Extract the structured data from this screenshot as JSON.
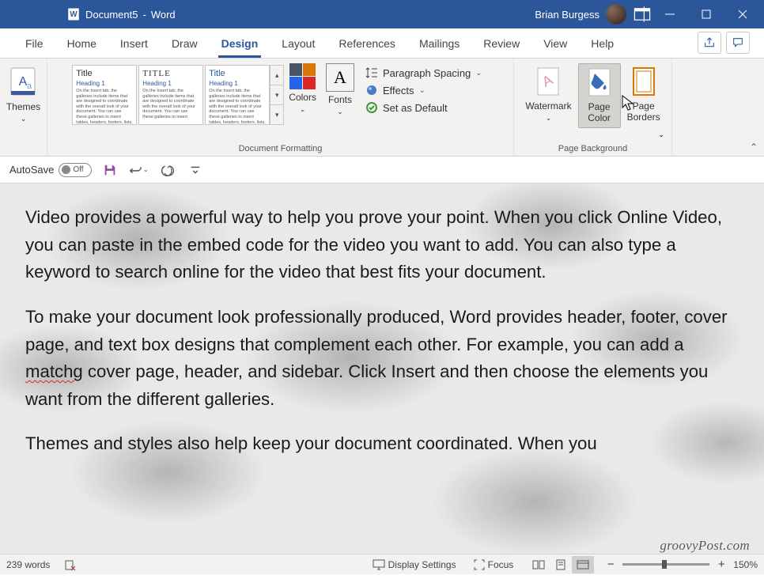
{
  "title": {
    "doc": "Document5",
    "app": "Word"
  },
  "user": {
    "name": "Brian Burgess"
  },
  "tabs": [
    "File",
    "Home",
    "Insert",
    "Draw",
    "Design",
    "Layout",
    "References",
    "Mailings",
    "Review",
    "View",
    "Help"
  ],
  "activeTab": 4,
  "ribbon": {
    "themes": "Themes",
    "formatting_label": "Document Formatting",
    "pagebg_label": "Page Background",
    "colors": "Colors",
    "fonts": "Fonts",
    "gallery": [
      {
        "title": "Title",
        "heading": "Heading 1"
      },
      {
        "title": "TITLE",
        "heading": "Heading 1"
      },
      {
        "title": "Title",
        "heading": "Heading 1"
      }
    ],
    "opts": {
      "paragraph": "Paragraph Spacing",
      "effects": "Effects",
      "default": "Set as Default"
    },
    "watermark": "Watermark",
    "pagecolor": "Page\nColor",
    "pageborders": "Page\nBorders"
  },
  "qa": {
    "autosave": "AutoSave",
    "off": "Off"
  },
  "doc": {
    "p1": "Video provides a powerful way to help you prove your point. When you click Online Video, you can paste in the embed code for the video you want to add. You can also type a keyword to search online for the video that best fits your document.",
    "p2a": "To make your document look professionally produced, Word provides header, footer, cover page, and text box designs that complement each other. For example, you can add a ",
    "p2err": "matchg",
    "p2b": " cover page, header, and sidebar. Click Insert and then choose the elements you want from the different galleries.",
    "p3": "Themes and styles also help keep your document coordinated. When you"
  },
  "status": {
    "words": "239 words",
    "display": "Display Settings",
    "focus": "Focus",
    "zoom": "150%"
  },
  "watermark": "groovyPost.com"
}
